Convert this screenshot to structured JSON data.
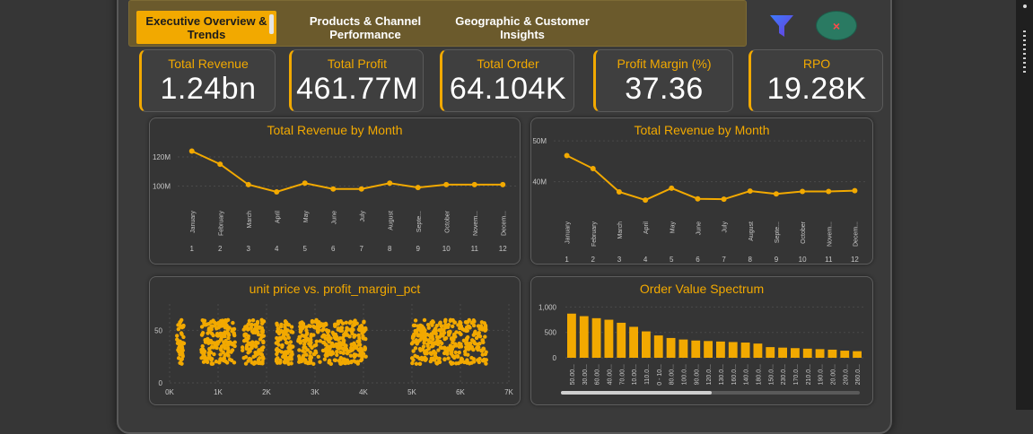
{
  "tabs": [
    {
      "label": "Executive Overview & Trends",
      "active": true
    },
    {
      "label": "Products & Channel Performance",
      "active": false
    },
    {
      "label": "Geographic & Customer Insights",
      "active": false
    }
  ],
  "toolbar": {
    "funnel_icon": "filter-funnel-icon",
    "clear_icon": "clear-filters-icon",
    "clear_glyph": "×"
  },
  "kpis": [
    {
      "label": "Total Revenue",
      "value": "1.24bn"
    },
    {
      "label": "Total Profit",
      "value": "461.77M"
    },
    {
      "label": "Total Order",
      "value": "64.104K"
    },
    {
      "label": "Profit Margin (%)",
      "value": "37.36"
    },
    {
      "label": "RPO",
      "value": "19.28K"
    }
  ],
  "colors": {
    "accent": "#f2a900",
    "background": "#3a3a3a",
    "tab_bar": "#6b5a2c",
    "clear_button": "#2a7a62"
  },
  "chart_data": [
    {
      "type": "line",
      "title": "Total Revenue by Month",
      "categories": [
        "January",
        "February",
        "March",
        "April",
        "May",
        "June",
        "July",
        "August",
        "Septe...",
        "October",
        "Novem...",
        "Decem..."
      ],
      "month_numbers": [
        "1",
        "2",
        "3",
        "4",
        "5",
        "6",
        "7",
        "8",
        "9",
        "10",
        "11",
        "12"
      ],
      "y_ticks": [
        {
          "value": 100,
          "label": "100M"
        },
        {
          "value": 120,
          "label": "120M"
        }
      ],
      "ylim": [
        88,
        128
      ],
      "values": [
        124,
        115,
        101,
        96,
        102,
        98,
        98,
        102,
        99,
        101,
        101,
        101
      ]
    },
    {
      "type": "line",
      "title": "Total Revenue by Month",
      "categories": [
        "January",
        "February",
        "March",
        "April",
        "May",
        "June",
        "July",
        "August",
        "Septe...",
        "October",
        "Novem...",
        "Decem..."
      ],
      "month_numbers": [
        "1",
        "2",
        "3",
        "4",
        "5",
        "6",
        "7",
        "8",
        "9",
        "10",
        "11",
        "12"
      ],
      "y_ticks": [
        {
          "value": 40,
          "label": "40M"
        },
        {
          "value": 50,
          "label": "50M"
        }
      ],
      "ylim": [
        32,
        52
      ],
      "values": [
        46.4,
        43.2,
        37.5,
        35.5,
        38.4,
        35.8,
        35.7,
        37.7,
        37.0,
        37.6,
        37.6,
        37.8
      ]
    },
    {
      "type": "scatter",
      "title": "unit price vs. profit_margin_pct",
      "x_ticks": [
        {
          "value": 0,
          "label": "0K"
        },
        {
          "value": 1000,
          "label": "1K"
        },
        {
          "value": 2000,
          "label": "2K"
        },
        {
          "value": 3000,
          "label": "3K"
        },
        {
          "value": 4000,
          "label": "4K"
        },
        {
          "value": 5000,
          "label": "5K"
        },
        {
          "value": 6000,
          "label": "6K"
        },
        {
          "value": 7000,
          "label": "7K"
        }
      ],
      "y_ticks": [
        {
          "value": 0,
          "label": "0"
        },
        {
          "value": 50,
          "label": "50"
        }
      ],
      "xlim": [
        0,
        7000
      ],
      "ylim": [
        0,
        70
      ],
      "clusters": [
        {
          "x_range": [
            150,
            300
          ],
          "y_range": [
            18,
            60
          ],
          "count": 45
        },
        {
          "x_range": [
            650,
            1350
          ],
          "y_range": [
            18,
            60
          ],
          "count": 170
        },
        {
          "x_range": [
            1500,
            1950
          ],
          "y_range": [
            18,
            60
          ],
          "count": 110
        },
        {
          "x_range": [
            2200,
            2550
          ],
          "y_range": [
            18,
            60
          ],
          "count": 90
        },
        {
          "x_range": [
            2650,
            4050
          ],
          "y_range": [
            18,
            60
          ],
          "count": 320
        },
        {
          "x_range": [
            5000,
            6550
          ],
          "y_range": [
            18,
            60
          ],
          "count": 330
        }
      ]
    },
    {
      "type": "bar",
      "title": "Order Value Spectrum",
      "y_ticks": [
        {
          "value": 0,
          "label": "0"
        },
        {
          "value": 500,
          "label": "500"
        },
        {
          "value": 1000,
          "label": "1,000"
        }
      ],
      "ylim": [
        0,
        1060
      ],
      "categories": [
        "50.00...",
        "30.00...",
        "60.00...",
        "40.00...",
        "70.00...",
        "10.00...",
        "110.0...",
        "0 - 10...",
        "80.00...",
        "100.0...",
        "90.00...",
        "120.0...",
        "130.0...",
        "160.0...",
        "140.0...",
        "180.0...",
        "150.0...",
        "230.0...",
        "170.0...",
        "210.0...",
        "190.0...",
        "20.00...",
        "200.0...",
        "260.0..."
      ],
      "values": [
        870,
        820,
        780,
        750,
        690,
        610,
        520,
        440,
        390,
        360,
        340,
        330,
        320,
        310,
        300,
        280,
        210,
        200,
        190,
        180,
        170,
        160,
        140,
        130
      ]
    }
  ]
}
